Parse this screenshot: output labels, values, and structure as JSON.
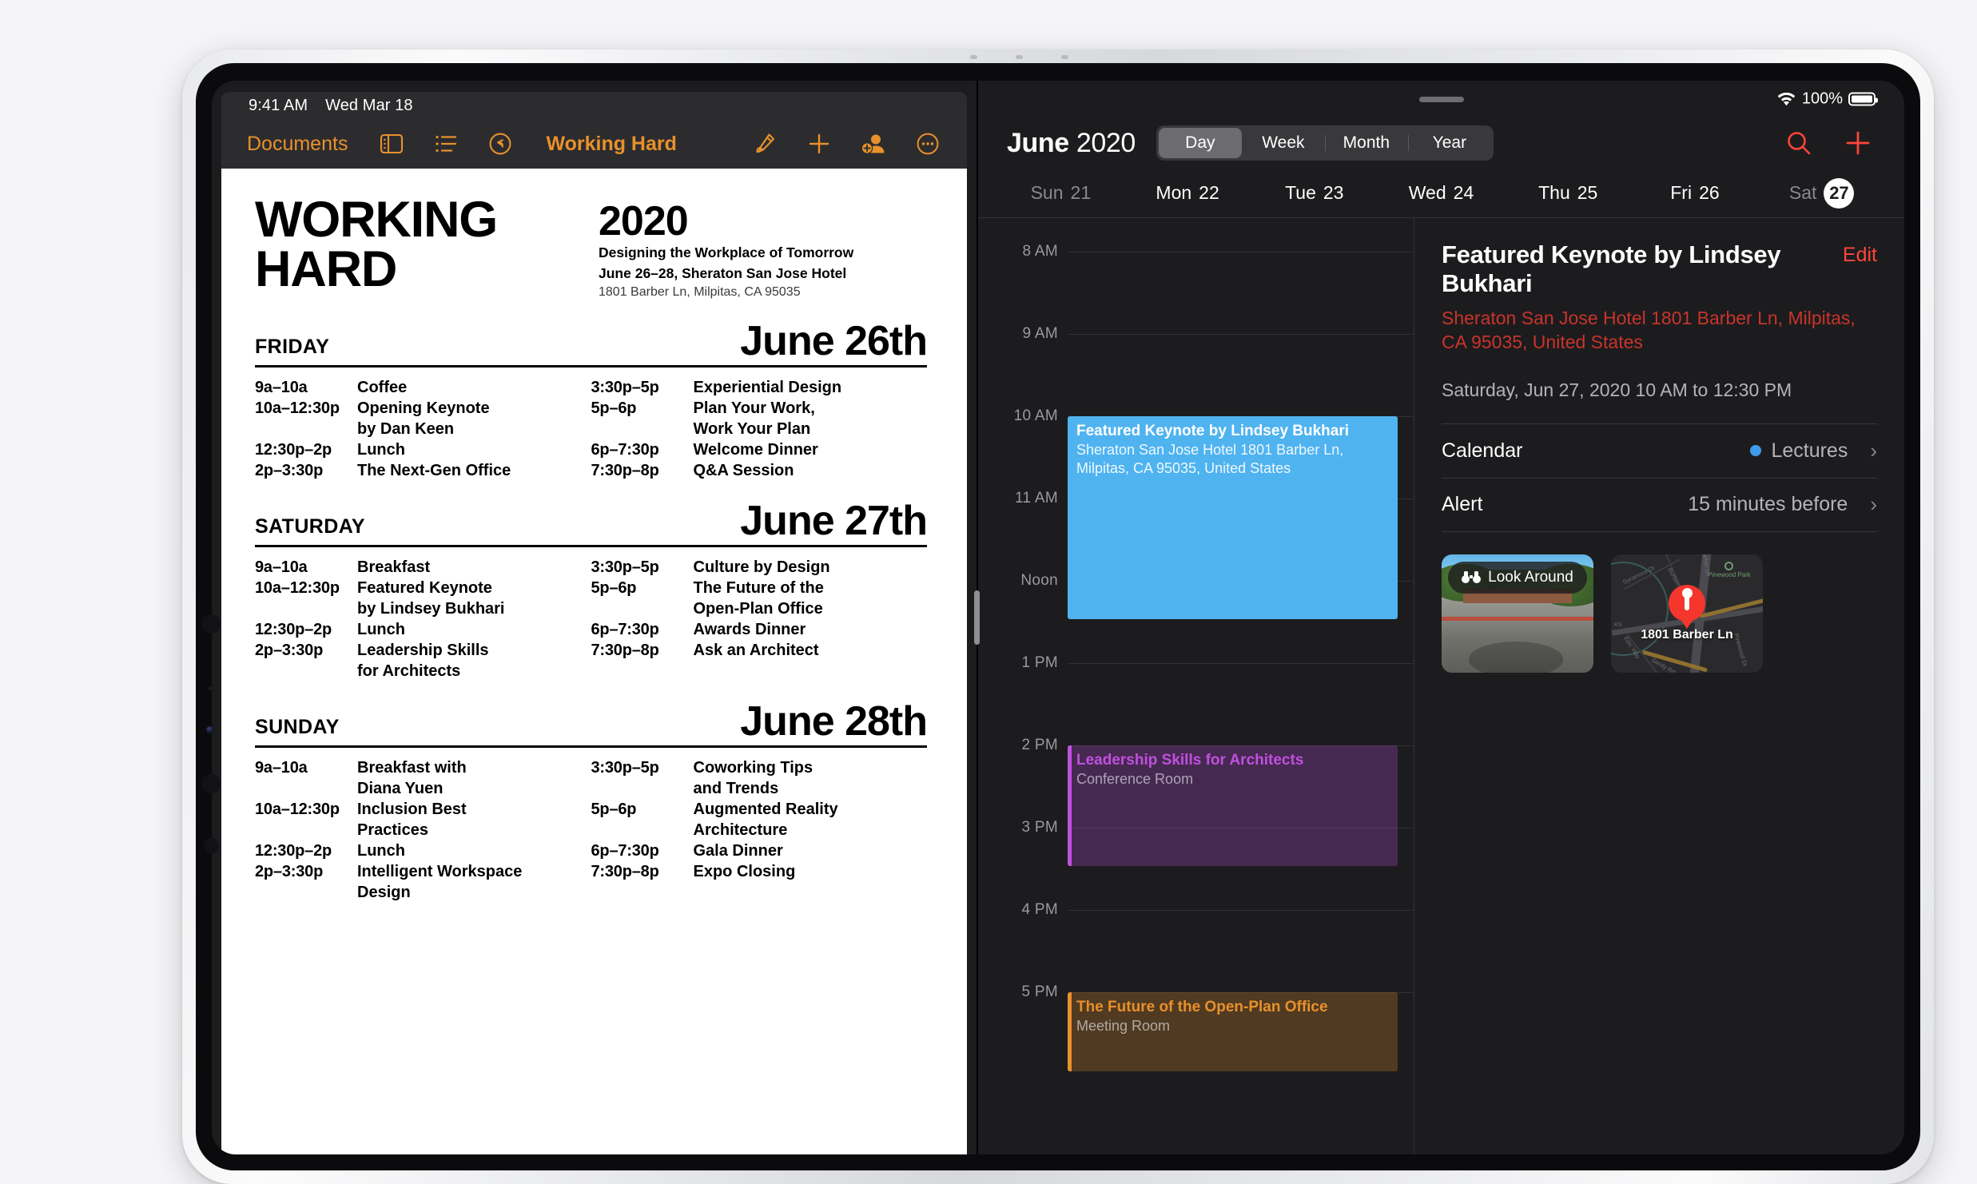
{
  "device": {
    "type": "ipad-pro"
  },
  "left_pane": {
    "status_bar": {
      "time": "9:41 AM",
      "date": "Wed Mar 18"
    },
    "toolbar": {
      "documents_label": "Documents",
      "title": "Working Hard",
      "icons": [
        "sidebar-icon",
        "list-icon",
        "undo-icon",
        "pen-icon",
        "plus-icon",
        "collaborate-icon",
        "more-icon"
      ]
    },
    "document": {
      "title_line1": "WORKING",
      "title_line2": "HARD",
      "year": "2020",
      "tagline": "Designing the Workplace of Tomorrow",
      "venue": "June 26–28, Sheraton San Jose Hotel",
      "address": "1801 Barber Ln, Milpitas, CA 95035",
      "days": [
        {
          "name": "FRIDAY",
          "date": "June 26th",
          "left": [
            {
              "time": "9a–10a",
              "item": "Coffee"
            },
            {
              "time": "10a–12:30p",
              "item": "Opening Keynote\nby Dan Keen"
            },
            {
              "time": "12:30p–2p",
              "item": "Lunch"
            },
            {
              "time": "2p–3:30p",
              "item": "The Next-Gen Office"
            }
          ],
          "right": [
            {
              "time": "3:30p–5p",
              "item": "Experiential Design"
            },
            {
              "time": "5p–6p",
              "item": "Plan Your Work,\nWork Your Plan"
            },
            {
              "time": "6p–7:30p",
              "item": "Welcome Dinner"
            },
            {
              "time": "7:30p–8p",
              "item": "Q&A Session"
            }
          ]
        },
        {
          "name": "SATURDAY",
          "date": "June 27th",
          "left": [
            {
              "time": "9a–10a",
              "item": "Breakfast"
            },
            {
              "time": "10a–12:30p",
              "item": "Featured Keynote\nby Lindsey Bukhari"
            },
            {
              "time": "12:30p–2p",
              "item": "Lunch"
            },
            {
              "time": "2p–3:30p",
              "item": "Leadership Skills\nfor Architects"
            }
          ],
          "right": [
            {
              "time": "3:30p–5p",
              "item": "Culture by Design"
            },
            {
              "time": "5p–6p",
              "item": "The Future of the\nOpen-Plan Office"
            },
            {
              "time": "6p–7:30p",
              "item": "Awards Dinner"
            },
            {
              "time": "7:30p–8p",
              "item": "Ask an Architect"
            }
          ]
        },
        {
          "name": "SUNDAY",
          "date": "June 28th",
          "left": [
            {
              "time": "9a–10a",
              "item": "Breakfast with\nDiana Yuen"
            },
            {
              "time": "10a–12:30p",
              "item": "Inclusion Best\nPractices"
            },
            {
              "time": "12:30p–2p",
              "item": "Lunch"
            },
            {
              "time": "2p–3:30p",
              "item": "Intelligent Workspace\nDesign"
            }
          ],
          "right": [
            {
              "time": "3:30p–5p",
              "item": "Coworking Tips\nand Trends"
            },
            {
              "time": "5p–6p",
              "item": "Augmented Reality\nArchitecture"
            },
            {
              "time": "6p–7:30p",
              "item": "Gala Dinner"
            },
            {
              "time": "7:30p–8p",
              "item": "Expo Closing"
            }
          ]
        }
      ]
    }
  },
  "right_pane": {
    "status": {
      "wifi": "wifi-icon",
      "battery_percent": "100%"
    },
    "header": {
      "month": "June",
      "year": "2020",
      "views": [
        {
          "label": "Day",
          "active": true
        },
        {
          "label": "Week",
          "active": false
        },
        {
          "label": "Month",
          "active": false
        },
        {
          "label": "Year",
          "active": false
        }
      ],
      "search_icon": "search-icon",
      "add_icon": "plus-icon"
    },
    "week_days": [
      {
        "dow": "Sun",
        "num": "21",
        "selected": false,
        "dim": true
      },
      {
        "dow": "Mon",
        "num": "22",
        "selected": false,
        "dim": false
      },
      {
        "dow": "Tue",
        "num": "23",
        "selected": false,
        "dim": false
      },
      {
        "dow": "Wed",
        "num": "24",
        "selected": false,
        "dim": false
      },
      {
        "dow": "Thu",
        "num": "25",
        "selected": false,
        "dim": false
      },
      {
        "dow": "Fri",
        "num": "26",
        "selected": false,
        "dim": false
      },
      {
        "dow": "Sat",
        "num": "27",
        "selected": true,
        "dim": true
      }
    ],
    "hours": [
      "8 AM",
      "9 AM",
      "10 AM",
      "11 AM",
      "Noon",
      "1 PM",
      "2 PM",
      "3 PM",
      "4 PM",
      "5 PM"
    ],
    "events": [
      {
        "title": "Featured Keynote by Lindsey Bukhari",
        "subtitle": "Sheraton San Jose Hotel 1801 Barber Ln, Milpitas, CA  95035, United States",
        "start_hour": "10 AM",
        "end_hour": "12:30 PM",
        "color": "#4fb3f0",
        "style": "filled"
      },
      {
        "title": "Leadership Skills for Architects",
        "subtitle": "Conference Room",
        "start_hour": "2 PM",
        "end_hour": "3:30 PM",
        "color": "#c050e0",
        "style": "tinted"
      },
      {
        "title": "The Future of the Open-Plan Office",
        "subtitle": "Meeting Room",
        "start_hour": "5 PM",
        "end_hour": "6 PM",
        "color": "#e8912b",
        "style": "tinted"
      }
    ],
    "detail": {
      "title": "Featured Keynote by Lindsey Bukhari",
      "edit_label": "Edit",
      "address": "Sheraton San Jose Hotel 1801 Barber Ln, Milpitas, CA  95035, United States",
      "when": "Saturday, Jun 27, 2020  10 AM to 12:30 PM",
      "rows": [
        {
          "label": "Calendar",
          "value": "Lectures",
          "dot_color": "#3f9bea"
        },
        {
          "label": "Alert",
          "value": "15 minutes before",
          "dot_color": null
        }
      ],
      "look_around_label": "Look Around",
      "map_pin_label": "1801\nBarber Ln",
      "map_labels": [
        "Sycamore Dr",
        "Burberry Dr",
        "Barber Ln",
        "Pinewood Park",
        "KS",
        "Epic Way",
        "Sandy Rd",
        "Pinewood Dr"
      ]
    }
  }
}
